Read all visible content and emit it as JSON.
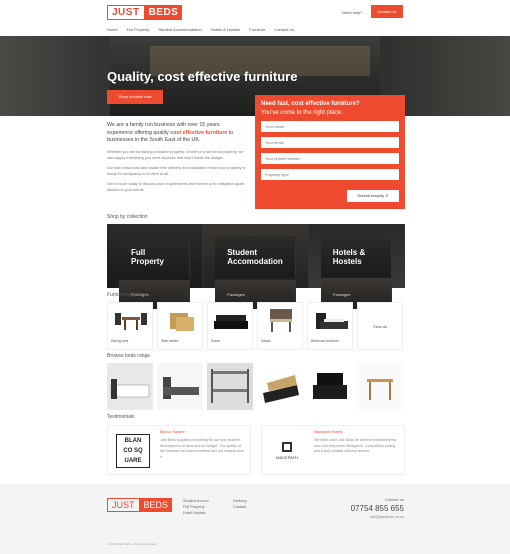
{
  "header": {
    "logo_part1": "JUST",
    "logo_part2": "BEDS",
    "link": "Need help?",
    "button": "Contact us"
  },
  "nav": [
    "Home",
    "Full Property",
    "Student Accommodation",
    "Hotels & Hostels",
    "Furniture",
    "Contact Us"
  ],
  "hero": {
    "title": "Quality, cost effective furniture",
    "button": "Shop bundles now"
  },
  "form": {
    "title": "Need fast, cost effective furniture?",
    "subtitle": "You've come to the right place.",
    "fields": [
      "Your name",
      "Your email",
      "Your phone number",
      "Property type"
    ],
    "submit": "Submit enquiry"
  },
  "intro": {
    "lead_a": "We are a family run business with over 15 years experience offering quality ",
    "lead_hl": "cost effective furniture",
    "lead_b": " to businesses in the South East of the UK.",
    "p1": "Whether you are furnishing a student property, a hotel or a full rental property, we can supply everything you need at prices that won't break the budget.",
    "p2": "Our fast turnaround and hassle free delivery and installation mean your property is ready for occupancy in no time at all.",
    "p3": "Get in touch today to discuss your requirements and receive a no obligation quote tailored to your needs."
  },
  "sections": {
    "collection": "Shop by collection",
    "furniture": "Furnishing options",
    "beds": "Browse beds range",
    "testimonials": "Testimonials"
  },
  "collections": [
    {
      "title": "Full Property",
      "sub": "Packages"
    },
    {
      "title": "Student Accomodation",
      "sub": "Packages"
    },
    {
      "title": "Hotels & Hostels",
      "sub": "Packages"
    }
  ],
  "furniture": [
    {
      "label": "Dining sets",
      "icon": "dining-set-icon"
    },
    {
      "label": "Side tables",
      "icon": "side-table-icon"
    },
    {
      "label": "Sofas",
      "icon": "sofa-icon"
    },
    {
      "label": "Desks",
      "icon": "desk-icon"
    },
    {
      "label": "Bedroom furniture",
      "icon": "bed-icon"
    },
    {
      "label": "View all",
      "icon": "more-icon"
    }
  ],
  "beds": [
    {
      "icon": "bed-photo-icon"
    },
    {
      "icon": "bed-frame-icon"
    },
    {
      "icon": "bunk-bed-icon"
    },
    {
      "icon": "storage-bed-icon"
    },
    {
      "icon": "armchair-icon"
    },
    {
      "icon": "table-icon"
    }
  ],
  "testimonials": [
    {
      "logo_lines": [
        "BLAN",
        "CO SQ",
        "UARE"
      ],
      "name": "Blanco Square",
      "text": "Just Beds supplied everything for our new student development on time and on budget. The quality of the furniture has been excellent and our tenants love it."
    },
    {
      "logo_lines": [
        "MACEPATH"
      ],
      "name": "Macepath Hotels",
      "text": "We have used Just Beds for several refurbishments now and they never disappoint. Competitive pricing and a truly reliable delivery service."
    }
  ],
  "footer": {
    "logo_part1": "JUST",
    "logo_part2": "BEDS",
    "col1": [
      "Student Accom",
      "Full Property",
      "Hotel Hostels"
    ],
    "col2": [
      "Delivery",
      "Contact"
    ],
    "contact_heading": "Contact us",
    "phone": "07754 855 655",
    "email": "info@justbeds.co.uk",
    "copyright": "© 2016 Just Beds. All rights reserved."
  },
  "colors": {
    "accent": "#ee4a2f",
    "dark": "#2a2a28"
  }
}
